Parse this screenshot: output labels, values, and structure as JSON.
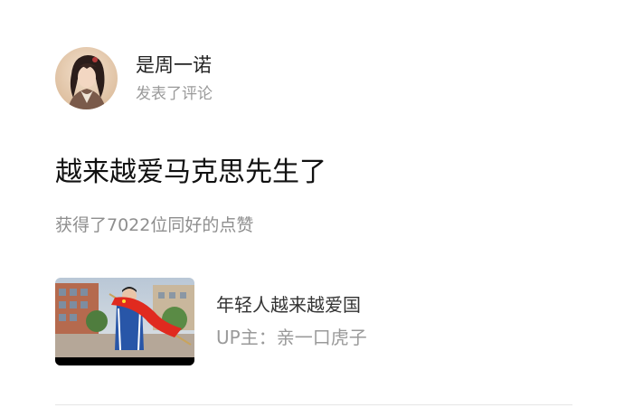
{
  "author": {
    "name": "是周一诺",
    "action": "发表了评论"
  },
  "comment": {
    "text": "越来越爱马克思先生了",
    "likes": "获得了7022位同好的点赞"
  },
  "video": {
    "title": "年轻人越来越爱国",
    "uploader": "UP主：亲一口虎子"
  },
  "colors": {
    "muted_text": "#9a9a9a",
    "divider": "#e6e6e6"
  }
}
